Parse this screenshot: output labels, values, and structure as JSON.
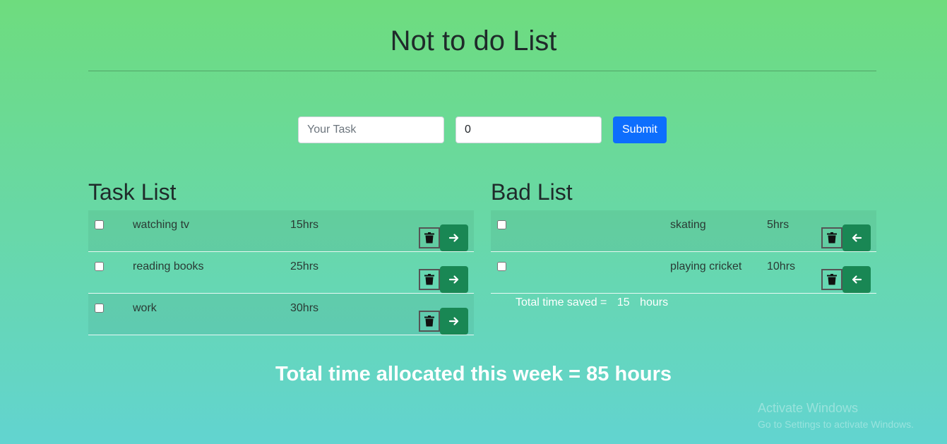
{
  "app": {
    "title": "Not to do List"
  },
  "form": {
    "task_placeholder": "Your Task",
    "hours_value": "0",
    "submit_label": "Submit"
  },
  "task_list": {
    "heading": "Task List",
    "rows": [
      {
        "name": "watching tv",
        "hours": "15hrs"
      },
      {
        "name": "reading books",
        "hours": "25hrs"
      },
      {
        "name": "work",
        "hours": "30hrs"
      }
    ]
  },
  "bad_list": {
    "heading": "Bad List",
    "rows": [
      {
        "name": "skating",
        "hours": "5hrs"
      },
      {
        "name": "playing cricket",
        "hours": "10hrs"
      }
    ],
    "saved_label": "Total time saved =",
    "saved_value": "15",
    "saved_unit": "hours"
  },
  "total": {
    "text": "Total time allocated this week = 85 hours"
  },
  "watermark": {
    "line1": "Activate Windows",
    "line2": "Go to Settings to activate Windows."
  },
  "icons": {
    "delete": "trash-icon",
    "move_right": "arrow-right-icon",
    "move_left": "arrow-left-icon"
  },
  "colors": {
    "primary": "#0d6efd",
    "success": "#198754"
  }
}
